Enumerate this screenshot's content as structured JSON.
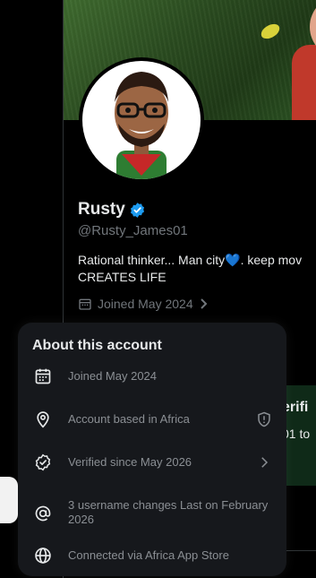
{
  "profile": {
    "display_name": "Rusty",
    "handle": "@Rusty_James01",
    "bio_line1": "Rational thinker... Man city💙. keep mov",
    "bio_line2": "CREATES LIFE",
    "joined": "Joined May 2024"
  },
  "background_card": {
    "line1": "erifi",
    "line2": "01 to"
  },
  "about_popover": {
    "title": "About this account",
    "rows": [
      {
        "icon": "calendar-icon",
        "text": "Joined May 2024"
      },
      {
        "icon": "location-pin-icon",
        "text": "Account based in Africa",
        "trailing_icon": "shield-info-icon"
      },
      {
        "icon": "verified-check-icon",
        "text": "Verified since May 2026",
        "trailing_icon": "chevron-right-icon"
      },
      {
        "icon": "at-sign-icon",
        "text": "3 username changes Last on February 2026"
      },
      {
        "icon": "globe-icon",
        "text": "Connected via Africa App Store"
      }
    ]
  },
  "colors": {
    "background": "#000000",
    "popover_bg": "#16181c",
    "verified_blue": "#1d9bf0",
    "muted_text": "#71767b"
  }
}
